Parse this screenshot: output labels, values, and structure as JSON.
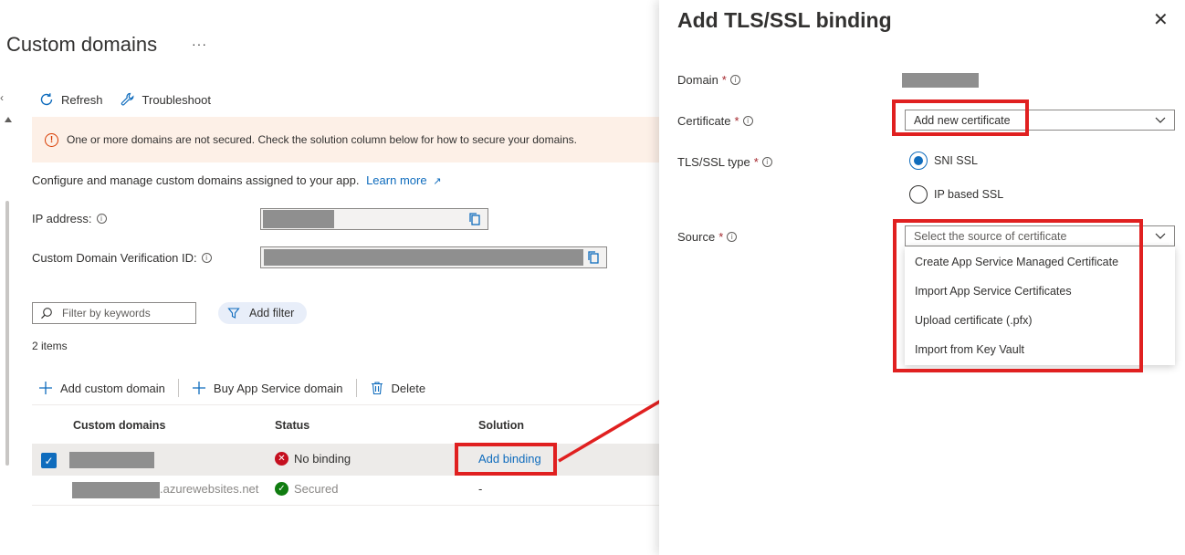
{
  "page": {
    "title": "Custom domains",
    "more": "···"
  },
  "toolbar": {
    "refresh": "Refresh",
    "troubleshoot": "Troubleshoot"
  },
  "warning": {
    "text": "One or more domains are not secured. Check the solution column below for how to secure your domains."
  },
  "description": {
    "text": "Configure and manage custom domains assigned to your app.",
    "learn_more": "Learn more"
  },
  "fields": {
    "ip_label": "IP address:",
    "verification_label": "Custom Domain Verification ID:"
  },
  "filter": {
    "placeholder": "Filter by keywords",
    "add_filter": "Add filter"
  },
  "items_count": "2 items",
  "commands": {
    "add_custom_domain": "Add custom domain",
    "buy_domain": "Buy App Service domain",
    "delete": "Delete"
  },
  "grid": {
    "columns": [
      "Custom domains",
      "Status",
      "Solution"
    ],
    "rows": [
      {
        "domain": "",
        "status": "No binding",
        "solution": "Add binding",
        "selected": true
      },
      {
        "domain": ".azurewebsites.net",
        "status": "Secured",
        "solution": "-",
        "selected": false
      }
    ]
  },
  "panel": {
    "title": "Add TLS/SSL binding",
    "domain_label": "Domain",
    "certificate_label": "Certificate",
    "certificate_value": "Add new certificate",
    "tls_type_label": "TLS/SSL type",
    "tls_options": [
      "SNI SSL",
      "IP based SSL"
    ],
    "tls_selected": "SNI SSL",
    "source_label": "Source",
    "source_placeholder": "Select the source of certificate",
    "source_options": [
      "Create App Service Managed Certificate",
      "Import App Service Certificates",
      "Upload certificate (.pfx)",
      "Import from Key Vault"
    ],
    "required_mark": "*"
  },
  "colors": {
    "accent": "#0f6cbd",
    "error": "#c50f1f",
    "success": "#107c10",
    "warning_bg": "#fdf0e7",
    "annotation_red": "#e02020"
  },
  "icons": {
    "refresh": "refresh-icon",
    "troubleshoot": "wrench-icon",
    "warning": "warning-icon",
    "external": "external-link-icon",
    "copy": "copy-icon",
    "search": "search-icon",
    "filter": "filter-icon",
    "add": "plus-icon",
    "delete": "trash-icon",
    "error": "error-circle-icon",
    "success": "check-circle-icon",
    "close": "close-icon",
    "chevron": "chevron-down-icon"
  }
}
